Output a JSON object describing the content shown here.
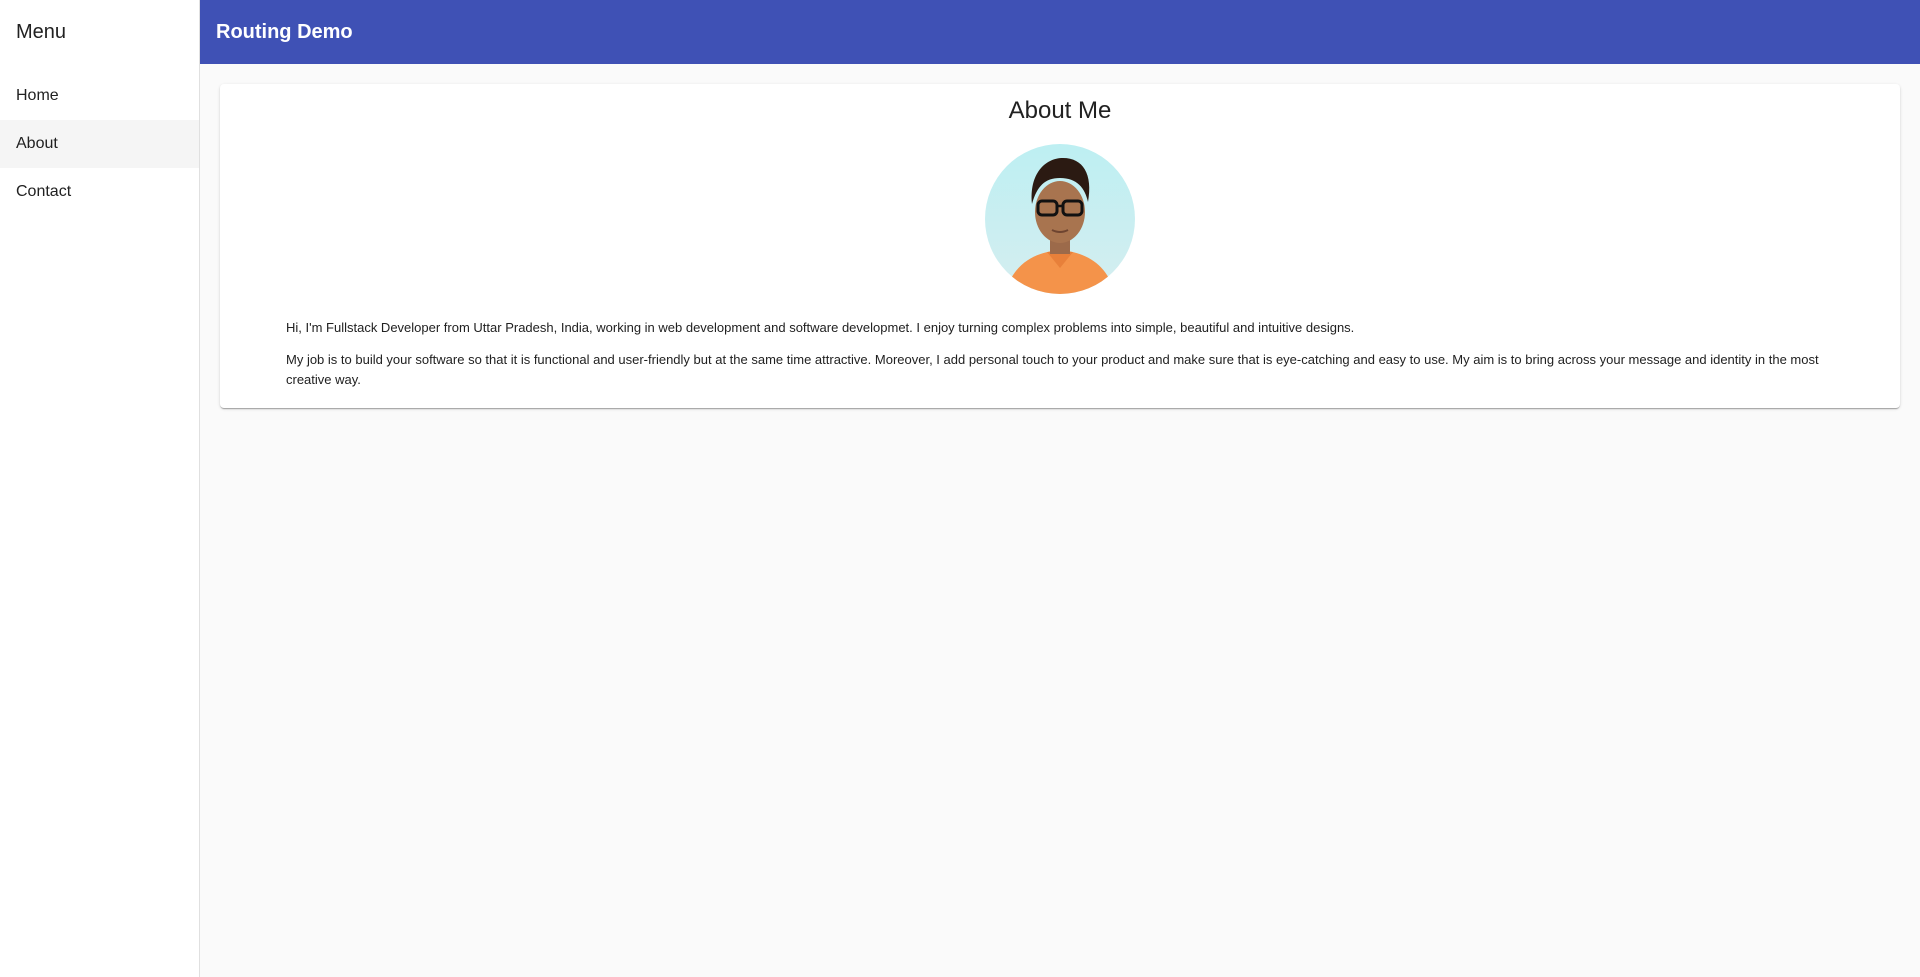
{
  "sidebar": {
    "title": "Menu",
    "items": [
      {
        "label": "Home"
      },
      {
        "label": "About"
      },
      {
        "label": "Contact"
      }
    ]
  },
  "toolbar": {
    "title": "Routing Demo",
    "color": "#3f51b5"
  },
  "card": {
    "title": "About Me",
    "avatar_icon": "profile-photo",
    "paragraphs": [
      "Hi, I'm Fullstack Developer from Uttar Pradesh, India, working in web development and software developmet. I enjoy turning complex problems into simple, beautiful and intuitive designs.",
      "My job is to build your software so that it is functional and user-friendly but at the same time attractive. Moreover, I add personal touch to your product and make sure that is eye-catching and easy to use. My aim is to bring across your message and identity in the most creative way."
    ]
  }
}
